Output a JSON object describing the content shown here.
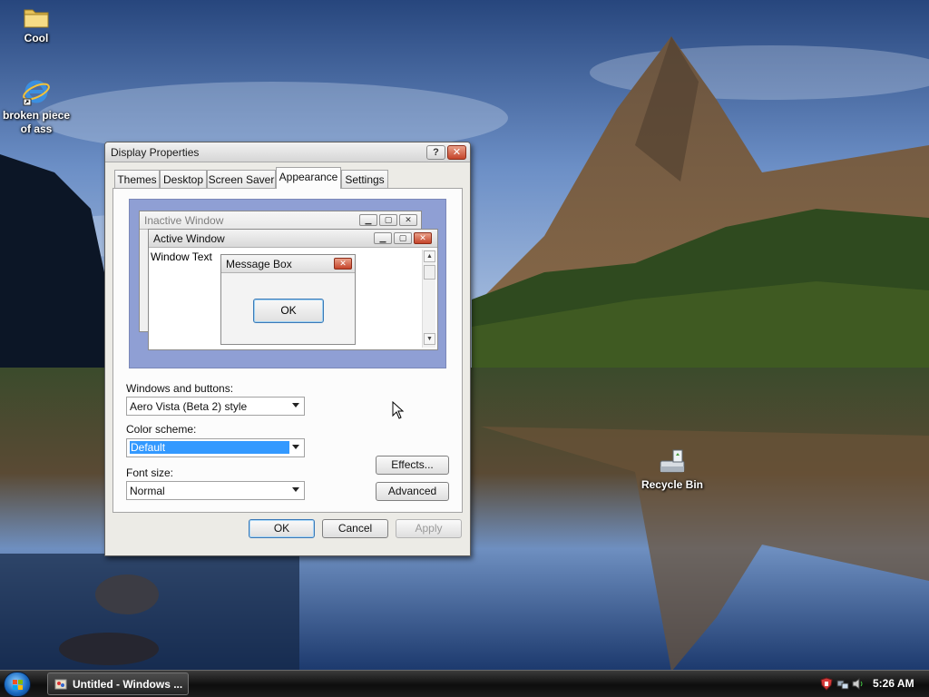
{
  "desktop": {
    "icons": [
      {
        "label": "Cool",
        "icon": "folder-icon"
      },
      {
        "label": "broken piece of ass",
        "icon": "internet-explorer-icon"
      },
      {
        "label": "Recycle Bin",
        "icon": "recycle-bin-icon"
      }
    ]
  },
  "dialog": {
    "title": "Display Properties",
    "help_label": "?",
    "close_label": "✕",
    "tabs": [
      {
        "label": "Themes",
        "active": false
      },
      {
        "label": "Desktop",
        "active": false
      },
      {
        "label": "Screen Saver",
        "active": false
      },
      {
        "label": "Appearance",
        "active": true
      },
      {
        "label": "Settings",
        "active": false
      }
    ],
    "preview": {
      "inactive_title": "Inactive Window",
      "active_title": "Active Window",
      "window_text": "Window Text",
      "message_title": "Message Box",
      "message_ok": "OK"
    },
    "windows_buttons_label": "Windows and buttons:",
    "windows_buttons_value": "Aero Vista (Beta 2) style",
    "color_scheme_label": "Color scheme:",
    "color_scheme_value": "Default",
    "font_size_label": "Font size:",
    "font_size_value": "Normal",
    "effects_label": "Effects...",
    "advanced_label": "Advanced",
    "ok_label": "OK",
    "cancel_label": "Cancel",
    "apply_label": "Apply"
  },
  "taskbar": {
    "start_icon": "windows-orb-icon",
    "task_item_label": "Untitled - Windows ...",
    "clock": "5:26 AM"
  },
  "colors": {
    "selection": "#3399ff",
    "preview_background": "#8f9fd4",
    "close_button": "#c5442a"
  }
}
